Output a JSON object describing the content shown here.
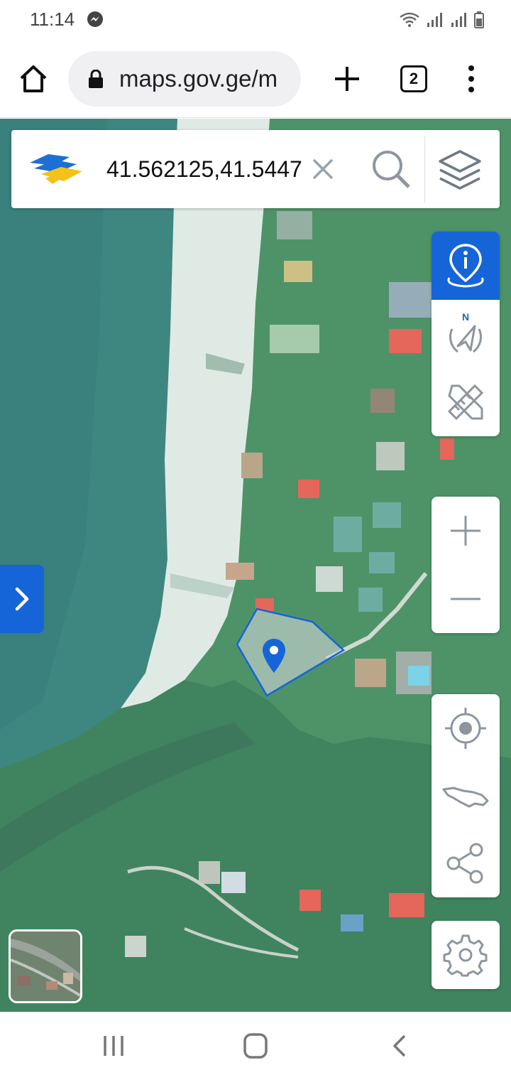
{
  "status_bar": {
    "time": "11:14",
    "icons": [
      "messenger-icon",
      "wifi-icon",
      "signal-icon",
      "signal-icon",
      "battery-icon"
    ]
  },
  "browser": {
    "url": "maps.gov.ge/m",
    "tab_count": "2",
    "icons": [
      "home-icon",
      "lock-icon",
      "plus-icon",
      "tabs-icon",
      "more-vert-icon"
    ]
  },
  "search": {
    "value": "41.562125,41.5447",
    "icons": [
      "logo",
      "close-icon",
      "search-icon",
      "layers-icon"
    ]
  },
  "tools": {
    "top_group": [
      "info-pin-icon",
      "compass-icon",
      "ruler-pencil-icon"
    ],
    "zoom_group": [
      "zoom-in-icon",
      "zoom-out-icon"
    ],
    "location_group": [
      "my-location-icon",
      "georgia-map-icon",
      "share-icon"
    ],
    "settings": "gear-icon",
    "active_color": "#1565d8"
  },
  "nav": {
    "icons": [
      "recent-apps-icon",
      "home-circle-icon",
      "back-icon"
    ]
  },
  "colors": {
    "accent": "#1565d8",
    "sea": "#2f7f74",
    "beach": "#dbe9e2",
    "forest": "#3a8a5d"
  }
}
